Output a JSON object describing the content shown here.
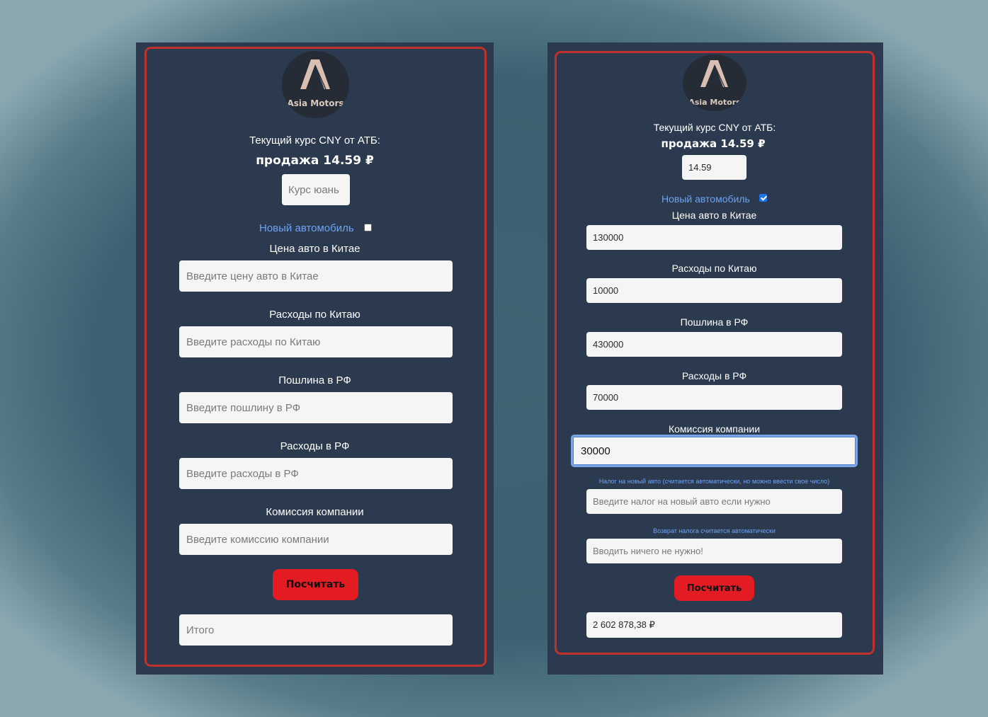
{
  "brand": {
    "name": "Asia Motors"
  },
  "left": {
    "rate_label": "Текущий курс CNY от АТБ:",
    "rate_sale": "продажа 14.59 ₽",
    "rate_input_placeholder": "Курс юань",
    "new_car_label": "Новый автомобиль",
    "new_car_checked": false,
    "fields": [
      {
        "label": "Цена авто в Китае",
        "placeholder": "Введите цену авто в Китае"
      },
      {
        "label": "Расходы по Китаю",
        "placeholder": "Введите расходы по Китаю"
      },
      {
        "label": "Пошлина в РФ",
        "placeholder": "Введите пошлину в РФ"
      },
      {
        "label": "Расходы в РФ",
        "placeholder": "Введите расходы в РФ"
      },
      {
        "label": "Комиссия компании",
        "placeholder": "Введите комиссию компании"
      }
    ],
    "calculate_label": "Посчитать",
    "total_placeholder": "Итого"
  },
  "right": {
    "rate_label": "Текущий курс CNY от АТБ:",
    "rate_sale": "продажа 14.59 ₽",
    "rate_value": "14.59",
    "new_car_label": "Новый автомобиль",
    "new_car_checked": true,
    "fields": [
      {
        "label": "Цена авто в Китае",
        "value": "130000"
      },
      {
        "label": "Расходы по Китаю",
        "value": "10000"
      },
      {
        "label": "Пошлина в РФ",
        "value": "430000"
      },
      {
        "label": "Расходы в РФ",
        "value": "70000"
      },
      {
        "label": "Комиссия компании",
        "value": "30000"
      }
    ],
    "tax_hint": "Налог на новый авто (считается автоматически, но можно ввести свое число)",
    "tax_placeholder": "Введите налог на новый авто если нужно",
    "refund_hint": "Возврат налога считается автоматически",
    "refund_placeholder": "Вводить ничего не нужно!",
    "calculate_label": "Посчитать",
    "total_value": "2 602 878,38 ₽"
  },
  "colors": {
    "panel": "#2b3a4f",
    "frame": "#c0302c",
    "button": "#e31b23",
    "link": "#6ea2f3"
  }
}
